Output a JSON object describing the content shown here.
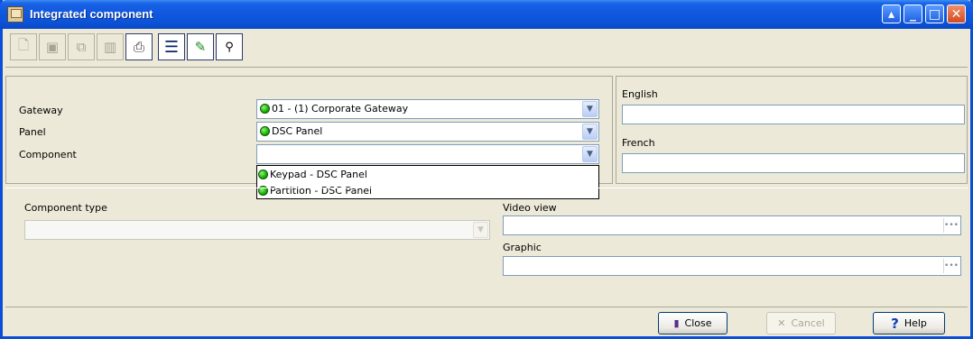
{
  "window": {
    "title": "Integrated component"
  },
  "toolbar": {
    "buttons": [
      {
        "name": "new-icon",
        "glyph": "🗋",
        "enabled": false
      },
      {
        "name": "save-icon",
        "glyph": "💾",
        "enabled": false
      },
      {
        "name": "copy-icon",
        "glyph": "⧉",
        "enabled": false
      },
      {
        "name": "delete-icon",
        "glyph": "🗑",
        "enabled": false
      },
      {
        "name": "print-icon",
        "glyph": "🖨",
        "enabled": true
      },
      {
        "name": "list-icon",
        "glyph": "☰",
        "enabled": true
      },
      {
        "name": "link-icon",
        "glyph": "✎",
        "enabled": true
      },
      {
        "name": "search-icon",
        "glyph": "🔭",
        "enabled": true
      }
    ]
  },
  "form": {
    "gateway_label": "Gateway",
    "gateway_value": "01 - (1)  Corporate Gateway",
    "panel_label": "Panel",
    "panel_value": "DSC Panel",
    "component_label": "Component",
    "component_value": "",
    "component_options": [
      "Keypad - DSC Panel",
      "Partition - DSC Panel"
    ],
    "english_label": "English",
    "english_value": "",
    "french_label": "French",
    "french_value": "",
    "component_type_label": "Component type",
    "component_type_value": "",
    "video_view_label": "Video view",
    "video_view_value": "",
    "graphic_label": "Graphic",
    "graphic_value": ""
  },
  "buttons": {
    "close": "Close",
    "cancel": "Cancel",
    "help": "Help"
  },
  "status_colors": {
    "online": "#17b000"
  }
}
